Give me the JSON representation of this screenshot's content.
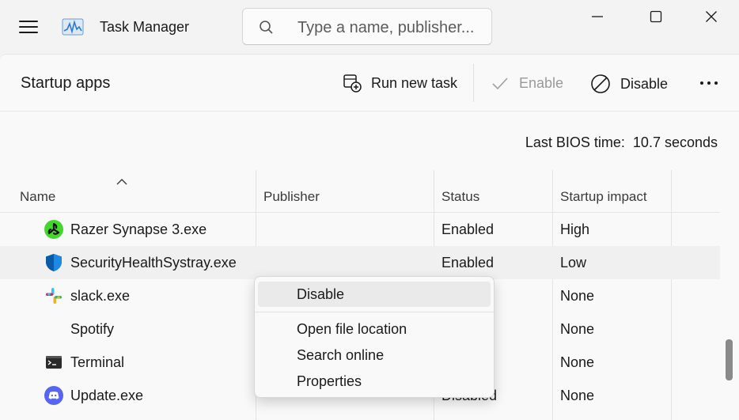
{
  "app": {
    "title": "Task Manager"
  },
  "search": {
    "placeholder": "Type a name, publisher..."
  },
  "page": {
    "title": "Startup apps"
  },
  "toolbar": {
    "run_new_task": "Run new task",
    "enable": "Enable",
    "disable": "Disable"
  },
  "bios": {
    "label": "Last BIOS time:",
    "value": "10.7 seconds"
  },
  "table": {
    "columns": {
      "name": "Name",
      "publisher": "Publisher",
      "status": "Status",
      "impact": "Startup impact"
    },
    "rows": [
      {
        "name": "Razer Synapse 3.exe",
        "publisher": "",
        "status": "Enabled",
        "impact": "High",
        "icon": "razer-icon"
      },
      {
        "name": "SecurityHealthSystray.exe",
        "publisher": "",
        "status": "Enabled",
        "impact": "Low",
        "icon": "shield-icon"
      },
      {
        "name": "slack.exe",
        "publisher": "",
        "status": "",
        "impact": "None",
        "icon": "slack-icon"
      },
      {
        "name": "Spotify",
        "publisher": "",
        "status": "",
        "impact": "None",
        "icon": ""
      },
      {
        "name": "Terminal",
        "publisher": "",
        "status": "",
        "impact": "None",
        "icon": "terminal-icon"
      },
      {
        "name": "Update.exe",
        "publisher": "",
        "status": "Disabled",
        "impact": "None",
        "icon": "discord-icon"
      }
    ]
  },
  "context_menu": {
    "items": [
      "Disable",
      "Open file location",
      "Search online",
      "Properties"
    ]
  },
  "colors": {
    "accent": "#0067c0",
    "razer": "#44d62c",
    "shield": "#0f6cbd",
    "discord": "#5865f2"
  }
}
